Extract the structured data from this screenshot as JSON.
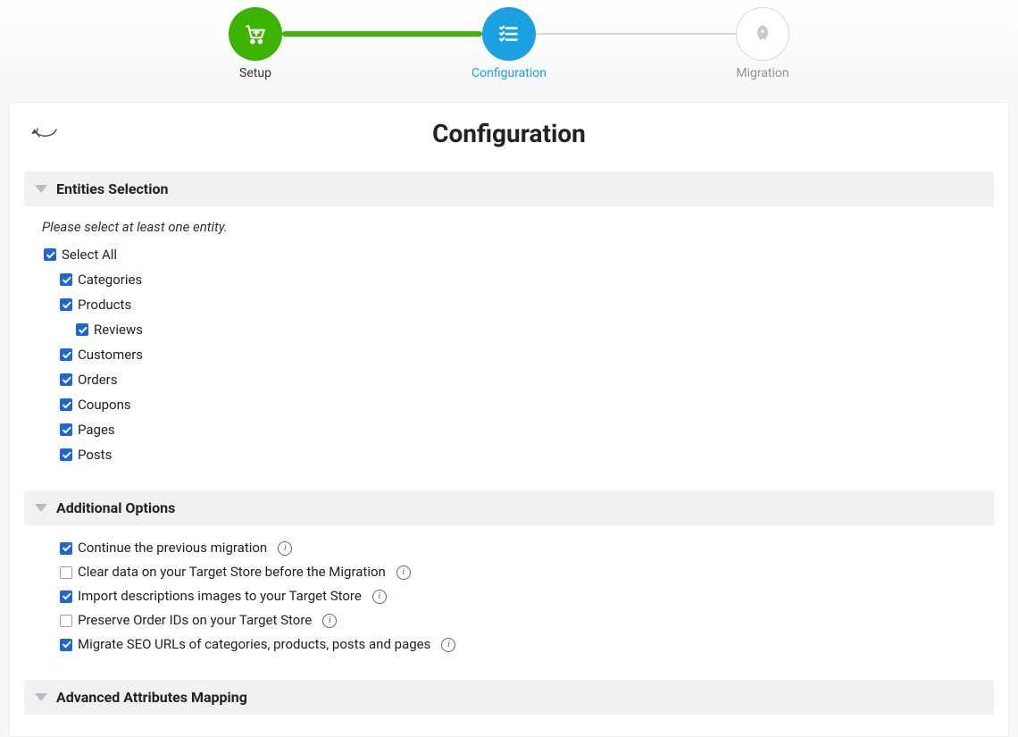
{
  "stepper": {
    "steps": [
      {
        "label": "Setup",
        "state": "done"
      },
      {
        "label": "Configuration",
        "state": "active"
      },
      {
        "label": "Migration",
        "state": "pending"
      }
    ]
  },
  "page": {
    "title": "Configuration"
  },
  "sections": {
    "entities": {
      "title": "Entities Selection",
      "hint": "Please select at least one entity.",
      "select_all_label": "Select All",
      "items": {
        "categories": "Categories",
        "products": "Products",
        "reviews": "Reviews",
        "customers": "Customers",
        "orders": "Orders",
        "coupons": "Coupons",
        "pages": "Pages",
        "posts": "Posts"
      }
    },
    "options": {
      "title": "Additional Options",
      "items": [
        {
          "label": "Continue the previous migration",
          "checked": true,
          "info": true
        },
        {
          "label": "Clear data on your Target Store before the Migration",
          "checked": false,
          "info": true
        },
        {
          "label": "Import descriptions images to your Target Store",
          "checked": true,
          "info": true
        },
        {
          "label": "Preserve Order IDs on your Target Store",
          "checked": false,
          "info": true
        },
        {
          "label": "Migrate SEO URLs of categories, products, posts and pages",
          "checked": true,
          "info": true
        }
      ]
    },
    "advanced": {
      "title": "Advanced Attributes Mapping"
    }
  }
}
